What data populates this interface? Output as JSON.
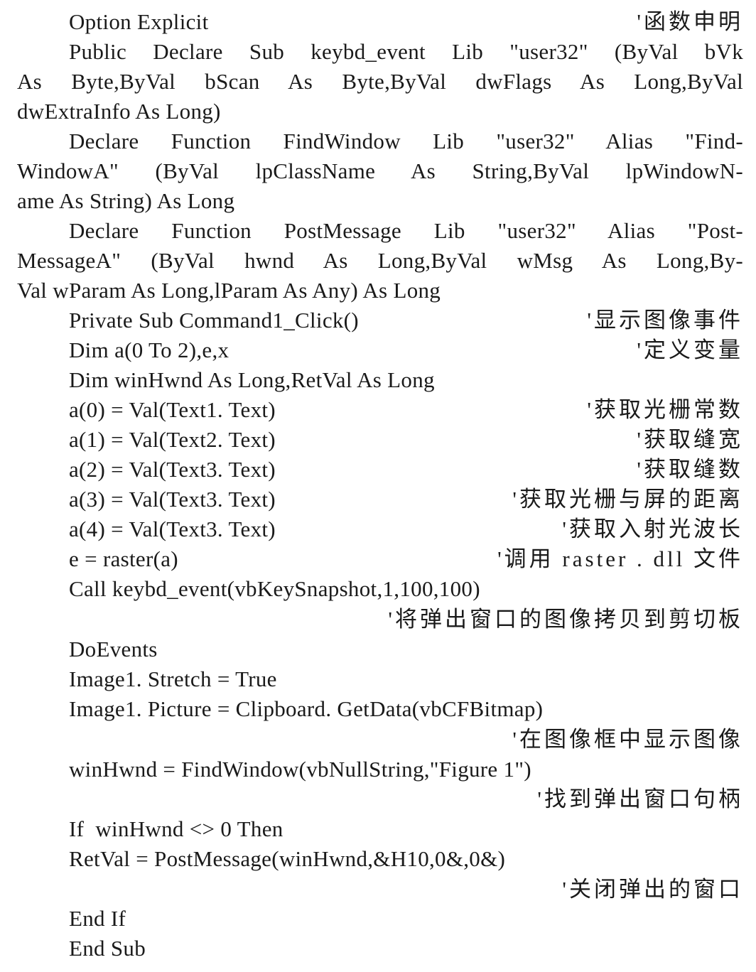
{
  "document": {
    "lines": [
      {
        "code": "Option Explicit",
        "comment": "'函数申明"
      },
      {
        "code": "Public Declare Sub keybd_event Lib \"user32\" (ByVal bVk"
      },
      {
        "code": "As Byte,ByVal bScan As Byte,ByVal dwFlags As Long,ByVal"
      },
      {
        "code": "dwExtraInfo As Long)"
      },
      {
        "code": "Declare Function FindWindow Lib \"user32\" Alias \"Find-"
      },
      {
        "code": "WindowA\" (ByVal lpClassName As String,ByVal lpWindowN-"
      },
      {
        "code": "ame As String) As Long"
      },
      {
        "code": "Declare Function PostMessage Lib \"user32\" Alias \"Post-"
      },
      {
        "code": "MessageA\" (ByVal hwnd As Long,ByVal wMsg As Long,By-"
      },
      {
        "code": "Val wParam As Long,lParam As Any) As Long"
      },
      {
        "code": "Private Sub Command1_Click()",
        "comment": "'显示图像事件"
      },
      {
        "code": "Dim a(0 To 2),e,x",
        "comment": "'定义变量"
      },
      {
        "code": "Dim winHwnd As Long,RetVal As Long"
      },
      {
        "code": "a(0) = Val(Text1. Text)",
        "comment": "'获取光栅常数"
      },
      {
        "code": "a(1) = Val(Text2. Text)",
        "comment": "'获取缝宽"
      },
      {
        "code": "a(2) = Val(Text3. Text)",
        "comment": "'获取缝数"
      },
      {
        "code": "a(3) = Val(Text3. Text)",
        "comment": "'获取光栅与屏的距离"
      },
      {
        "code": "a(4) = Val(Text3. Text)",
        "comment": "'获取入射光波长"
      },
      {
        "code": "e = raster(a)",
        "comment": "'调用 raster . dll 文件"
      },
      {
        "code": "Call keybd_event(vbKeySnapshot,1,100,100)"
      },
      {
        "code": "",
        "comment": "'将弹出窗口的图像拷贝到剪切板"
      },
      {
        "code": "DoEvents"
      },
      {
        "code": "Image1. Stretch = True"
      },
      {
        "code": "Image1. Picture = Clipboard. GetData(vbCFBitmap)"
      },
      {
        "code": "",
        "comment": "'在图像框中显示图像"
      },
      {
        "code": "winHwnd = FindWindow(vbNullString,\"Figure 1\")"
      },
      {
        "code": "",
        "comment": "'找到弹出窗口句柄"
      },
      {
        "code": "If  winHwnd <> 0 Then"
      },
      {
        "code": "RetVal = PostMessage(winHwnd,&H10,0&,0&)"
      },
      {
        "code": "",
        "comment": "'关闭弹出的窗口"
      },
      {
        "code": "End If"
      },
      {
        "code": "End Sub"
      }
    ]
  }
}
